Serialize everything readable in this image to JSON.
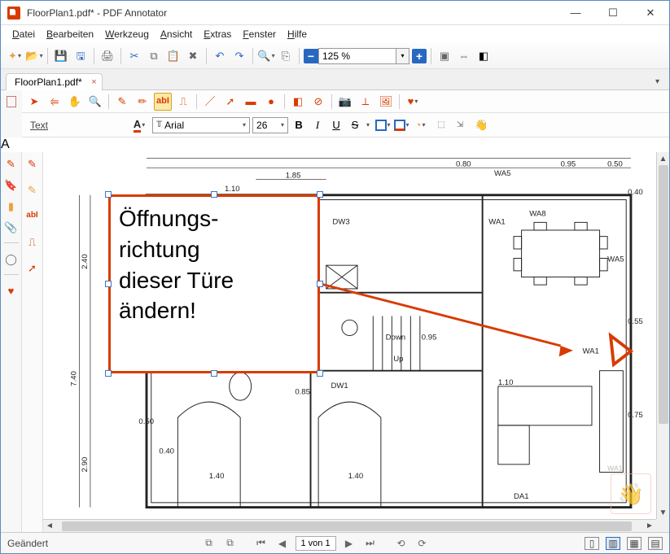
{
  "window": {
    "title": "FloorPlan1.pdf* - PDF Annotator"
  },
  "menu": {
    "file": "Datei",
    "edit": "Bearbeiten",
    "tool": "Werkzeug",
    "view": "Ansicht",
    "extras": "Extras",
    "window": "Fenster",
    "help": "Hilfe"
  },
  "toolbar": {
    "zoom_value": "125 %"
  },
  "tab": {
    "label": "FloorPlan1.pdf*"
  },
  "textbar": {
    "label": "Text",
    "font_name": "Arial",
    "font_size": "26",
    "bold": "B",
    "italic": "I",
    "underline": "U",
    "strike": "S"
  },
  "annotation": {
    "text": "Öffnungs-\nrichtung dieser Türe ändern!",
    "selected_tool_letter": "A"
  },
  "plan_labels": {
    "dim_185": "1.85",
    "dim_110t": "1.10",
    "dim_080": "0.80",
    "dim_095a": "0.95",
    "dim_050a": "0.50",
    "dim_240": "2.40",
    "dim_740": "7.40",
    "dim_290": "2.90",
    "dw3": "DW3",
    "wa5": "WA5",
    "wa1a": "WA1",
    "wa8": "WA8",
    "dim_040t": "0.40",
    "down": "Down",
    "up": "Up",
    "dim_095b": "0.95",
    "dw1": "DW1",
    "dim_085": "0.85",
    "dim_110b": "1.10",
    "dim_050b": "0.50",
    "dim_040b": "0.40",
    "dim_140a": "1.40",
    "dim_140b": "1.40",
    "da1": "DA1",
    "dim_075": "0.75",
    "dim_055": "0.55",
    "wa1b": "WA1",
    "wa1c": "WA1",
    "wa5b": "WA5"
  },
  "status": {
    "changed": "Geändert",
    "page_field": "1 von 1"
  }
}
